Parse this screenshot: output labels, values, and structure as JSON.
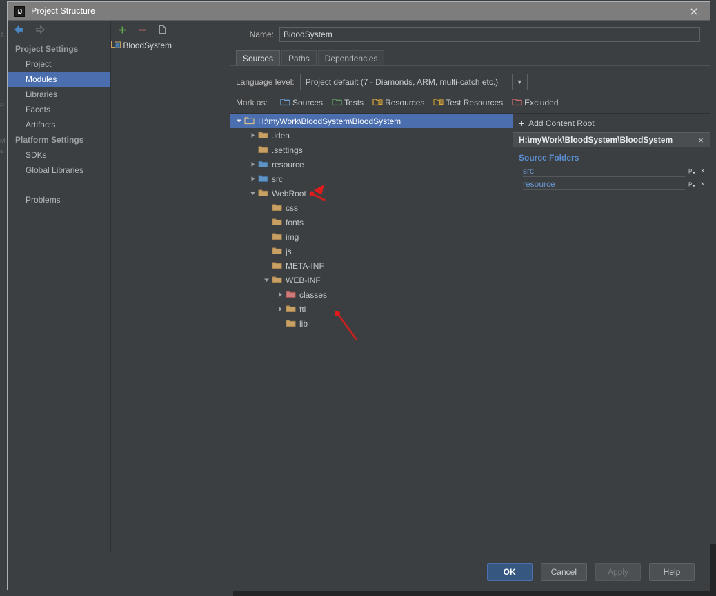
{
  "window": {
    "title": "Project Structure",
    "app_icon": "intellij-idea-icon",
    "close_label": "×"
  },
  "nav": {
    "back_icon": "arrow-left-icon",
    "forward_icon": "arrow-right-icon"
  },
  "sidebar": {
    "groups": [
      {
        "label": "Project Settings",
        "items": [
          {
            "label": "Project",
            "selected": false
          },
          {
            "label": "Modules",
            "selected": true
          },
          {
            "label": "Libraries",
            "selected": false
          },
          {
            "label": "Facets",
            "selected": false
          },
          {
            "label": "Artifacts",
            "selected": false
          }
        ]
      },
      {
        "label": "Platform Settings",
        "items": [
          {
            "label": "SDKs",
            "selected": false
          },
          {
            "label": "Global Libraries",
            "selected": false
          }
        ]
      }
    ],
    "problems": {
      "label": "Problems"
    }
  },
  "modules": {
    "toolbar": {
      "add_label": "+",
      "add_icon": "plus-icon",
      "remove_label": "−",
      "remove_icon": "minus-icon",
      "copy_icon": "copy-icon"
    },
    "items": [
      {
        "label": "BloodSystem",
        "icon": "module-icon",
        "selected": true
      }
    ]
  },
  "main": {
    "name_label": "Name:",
    "name_value": "BloodSystem",
    "name_placeholder": "",
    "tabs": [
      {
        "label": "Sources",
        "active": true
      },
      {
        "label": "Paths",
        "active": false
      },
      {
        "label": "Dependencies",
        "active": false
      }
    ],
    "language_level": {
      "label": "Language level:",
      "value": "Project default (7 - Diamonds, ARM, multi-catch etc.)",
      "arrow_icon": "chevron-down-icon"
    },
    "mark_as": {
      "label": "Mark as:",
      "options": [
        {
          "label": "Sources",
          "mnemonic": "S",
          "icon": "folder-sources-icon",
          "color": "#6ba4d8"
        },
        {
          "label": "Tests",
          "mnemonic": "T",
          "icon": "folder-tests-icon",
          "color": "#5fa05f"
        },
        {
          "label": "Resources",
          "mnemonic": "R",
          "icon": "folder-resources-icon",
          "color": "#d8a43a"
        },
        {
          "label": "Test Resources",
          "mnemonic": "T",
          "icon": "folder-test-resources-icon",
          "color": "#d8a43a"
        },
        {
          "label": "Excluded",
          "mnemonic": "E",
          "icon": "folder-excluded-icon",
          "color": "#d06a6a"
        }
      ]
    }
  },
  "tree": {
    "nodes": [
      {
        "label": "H:\\myWork\\BloodSystem\\BloodSystem",
        "depth": 0,
        "twisty": "down",
        "folder": "content-root",
        "selected": true
      },
      {
        "label": ".idea",
        "depth": 1,
        "twisty": "right",
        "folder": "normal",
        "selected": false
      },
      {
        "label": ".settings",
        "depth": 1,
        "twisty": "none",
        "folder": "normal",
        "selected": false
      },
      {
        "label": "resource",
        "depth": 1,
        "twisty": "right",
        "folder": "source",
        "selected": false
      },
      {
        "label": "src",
        "depth": 1,
        "twisty": "right",
        "folder": "source",
        "selected": false
      },
      {
        "label": "WebRoot",
        "depth": 1,
        "twisty": "down",
        "folder": "normal",
        "selected": false
      },
      {
        "label": "css",
        "depth": 2,
        "twisty": "none",
        "folder": "normal",
        "selected": false
      },
      {
        "label": "fonts",
        "depth": 2,
        "twisty": "none",
        "folder": "normal",
        "selected": false
      },
      {
        "label": "img",
        "depth": 2,
        "twisty": "none",
        "folder": "normal",
        "selected": false
      },
      {
        "label": "js",
        "depth": 2,
        "twisty": "none",
        "folder": "normal",
        "selected": false
      },
      {
        "label": "META-INF",
        "depth": 2,
        "twisty": "none",
        "folder": "normal",
        "selected": false
      },
      {
        "label": "WEB-INF",
        "depth": 2,
        "twisty": "down",
        "folder": "normal",
        "selected": false
      },
      {
        "label": "classes",
        "depth": 3,
        "twisty": "right",
        "folder": "excluded",
        "selected": false
      },
      {
        "label": "ftl",
        "depth": 3,
        "twisty": "right",
        "folder": "normal",
        "selected": false
      },
      {
        "label": "lib",
        "depth": 3,
        "twisty": "none",
        "folder": "normal",
        "selected": false
      }
    ]
  },
  "sidepane": {
    "add_content_root": {
      "label": "Add Content Root",
      "mnemonic": "C",
      "plus": "+",
      "icon": "plus-icon"
    },
    "content_root": {
      "path": "H:\\myWork\\BloodSystem\\BloodSystem",
      "close_label": "×",
      "close_icon": "close-icon"
    },
    "source_folders_title": "Source Folders",
    "source_folders": [
      {
        "name": "src",
        "props_icon": "properties-icon",
        "remove_icon": "close-icon",
        "props_label": "P",
        "remove_label": "×"
      },
      {
        "name": "resource",
        "props_icon": "properties-icon",
        "remove_icon": "close-icon",
        "props_label": "P",
        "remove_label": "×"
      }
    ]
  },
  "footer": {
    "buttons": [
      {
        "label": "OK",
        "style": "default"
      },
      {
        "label": "Cancel",
        "style": "normal"
      },
      {
        "label": "Apply",
        "style": "disabled"
      },
      {
        "label": "Help",
        "style": "normal"
      }
    ]
  },
  "annotations": {
    "color": "#e01b1b",
    "arrows": [
      {
        "name": "arrow-pointing-to-src"
      },
      {
        "name": "arrow-pointing-to-classes"
      }
    ]
  },
  "backdrop": {
    "ghost_lines": [
      "A",
      "P",
      "M",
      "s"
    ]
  }
}
